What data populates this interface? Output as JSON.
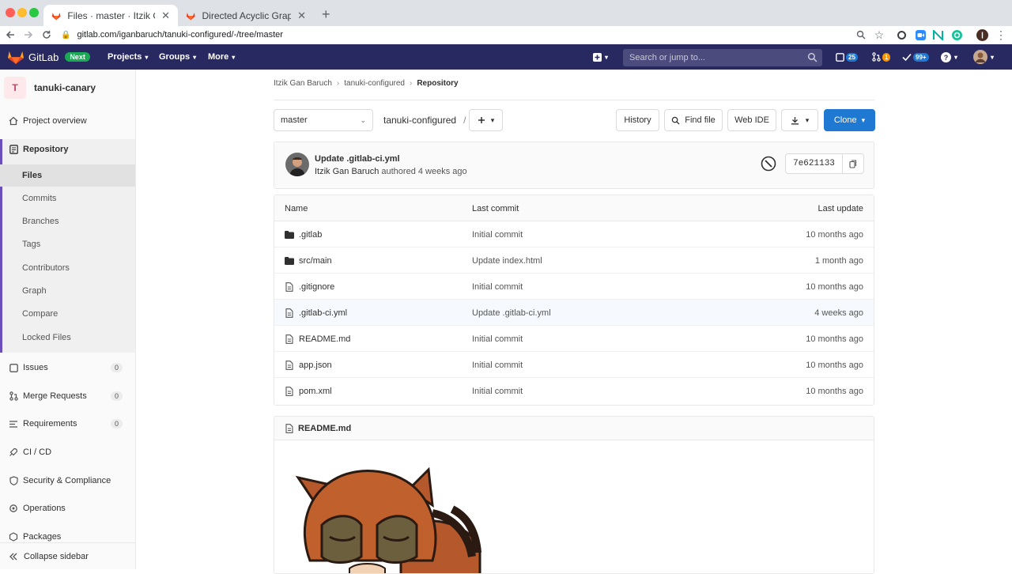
{
  "browser": {
    "tabs": [
      {
        "title": "Files · master · Itzik Gan Baruch",
        "active": true
      },
      {
        "title": "Directed Acyclic Graph | GitLab",
        "active": false
      }
    ],
    "url": "gitlab.com/iganbaruch/tanuki-configured/-/tree/master"
  },
  "gitlab_nav": {
    "brand": "GitLab",
    "badge": "Next",
    "menus": [
      "Projects",
      "Groups",
      "More"
    ],
    "search_placeholder": "Search or jump to...",
    "counts": {
      "issues": "25",
      "mrs": "1",
      "todos": "99+"
    }
  },
  "sidebar": {
    "project_initial": "T",
    "project_name": "tanuki-canary",
    "top_items": [
      {
        "label": "Project overview"
      },
      {
        "label": "Repository"
      }
    ],
    "repo_sub": [
      "Files",
      "Commits",
      "Branches",
      "Tags",
      "Contributors",
      "Graph",
      "Compare",
      "Locked Files"
    ],
    "lower_items": [
      {
        "label": "Issues",
        "count": "0"
      },
      {
        "label": "Merge Requests",
        "count": "0"
      },
      {
        "label": "Requirements",
        "count": "0"
      },
      {
        "label": "CI / CD"
      },
      {
        "label": "Security & Compliance"
      },
      {
        "label": "Operations"
      },
      {
        "label": "Packages"
      }
    ],
    "collapse": "Collapse sidebar"
  },
  "breadcrumb": [
    "Itzik Gan Baruch",
    "tanuki-configured",
    "Repository"
  ],
  "toolbar": {
    "branch": "master",
    "path": "tanuki-configured",
    "path_sep": "/",
    "history": "History",
    "find_file": "Find file",
    "web_ide": "Web IDE",
    "clone": "Clone"
  },
  "last_commit": {
    "title": "Update .gitlab-ci.yml",
    "author": "Itzik Gan Baruch",
    "authored": "authored 4 weeks ago",
    "sha": "7e621133"
  },
  "files": {
    "headers": [
      "Name",
      "Last commit",
      "Last update"
    ],
    "rows": [
      {
        "name": ".gitlab",
        "type": "folder",
        "commit": "Initial commit",
        "updated": "10 months ago"
      },
      {
        "name": "src/main",
        "type": "folder",
        "commit": "Update index.html",
        "updated": "1 month ago"
      },
      {
        "name": ".gitignore",
        "type": "file",
        "commit": "Initial commit",
        "updated": "10 months ago"
      },
      {
        "name": ".gitlab-ci.yml",
        "type": "file",
        "commit": "Update .gitlab-ci.yml",
        "updated": "4 weeks ago"
      },
      {
        "name": "README.md",
        "type": "file",
        "commit": "Initial commit",
        "updated": "10 months ago"
      },
      {
        "name": "app.json",
        "type": "file",
        "commit": "Initial commit",
        "updated": "10 months ago"
      },
      {
        "name": "pom.xml",
        "type": "file",
        "commit": "Initial commit",
        "updated": "10 months ago"
      }
    ]
  },
  "readme": {
    "title": "README.md"
  },
  "colors": {
    "nav": "#292961",
    "primary": "#1f78d1",
    "accent": "#6b4fbb"
  }
}
